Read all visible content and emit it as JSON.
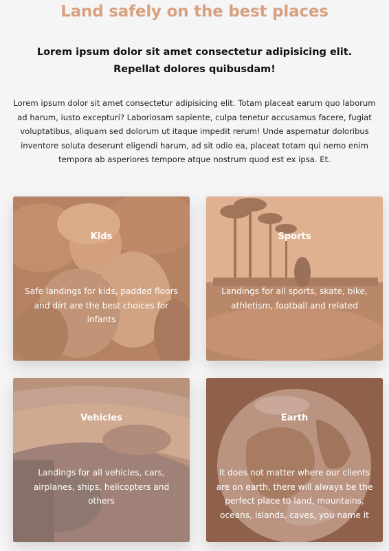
{
  "heading": "Land safely on the best places",
  "subheading": "Lorem ipsum dolor sit amet consectetur adipisicing elit. Repellat dolores quibusdam!",
  "intro": "Lorem ipsum dolor sit amet consectetur adipisicing elit. Totam placeat earum quo laborum ad harum, iusto excepturi? Laboriosam sapiente, culpa tenetur accusamus facere, fugiat voluptatibus, aliquam sed dolorum ut itaque impedit rerum! Unde aspernatur doloribus inventore soluta deserunt eligendi harum, ad sit odio ea, placeat totam qui nemo enim tempora ab asperiores tempore atque nostrum quod est ex ipsa. Et.",
  "cards": [
    {
      "title": "Kids",
      "description": "Safe landings for kids, padded floors and dirt are the best choices for infants"
    },
    {
      "title": "Sports",
      "description": "Landings for all sports, skate, bike, athletism, football and related"
    },
    {
      "title": "Vehicles",
      "description": "Landings for all vehicles, cars, airplanes, ships, helicopters and others"
    },
    {
      "title": "Earth",
      "description": "It does not matter where our clients are on earth, there will always be the perfect place to land, mountains, oceans, islands, caves, you name it"
    }
  ],
  "colors": {
    "heading": "#d8a07f",
    "overlay": "#d8a07f",
    "background": "#f6f5f5"
  }
}
